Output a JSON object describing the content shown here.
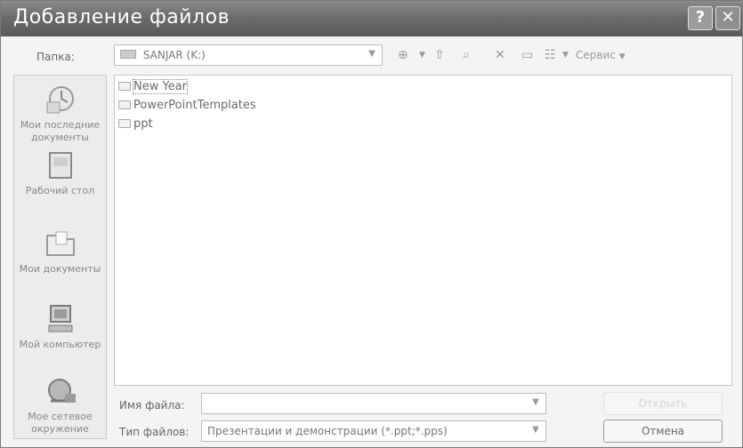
{
  "window": {
    "title": "Добавление файлов"
  },
  "toolbar": {
    "folder_label": "Папка:",
    "folder_value": "SANJAR (K:)",
    "tools_label": "Сервис"
  },
  "places": [
    {
      "label": "Мои последние документы"
    },
    {
      "label": "Рабочий стол"
    },
    {
      "label": "Мои документы"
    },
    {
      "label": "Мой компьютер"
    },
    {
      "label": "Мое сетевое окружение"
    }
  ],
  "files": [
    {
      "name": "New Year"
    },
    {
      "name": "PowerPointTemplates"
    },
    {
      "name": "ppt"
    }
  ],
  "bottom": {
    "filename_label": "Имя файла:",
    "filename_value": "",
    "filetype_label": "Тип файлов:",
    "filetype_value": "Презентации и демонстрации (*.ppt;*.pps)",
    "open_label": "Открыть",
    "cancel_label": "Отмена"
  }
}
